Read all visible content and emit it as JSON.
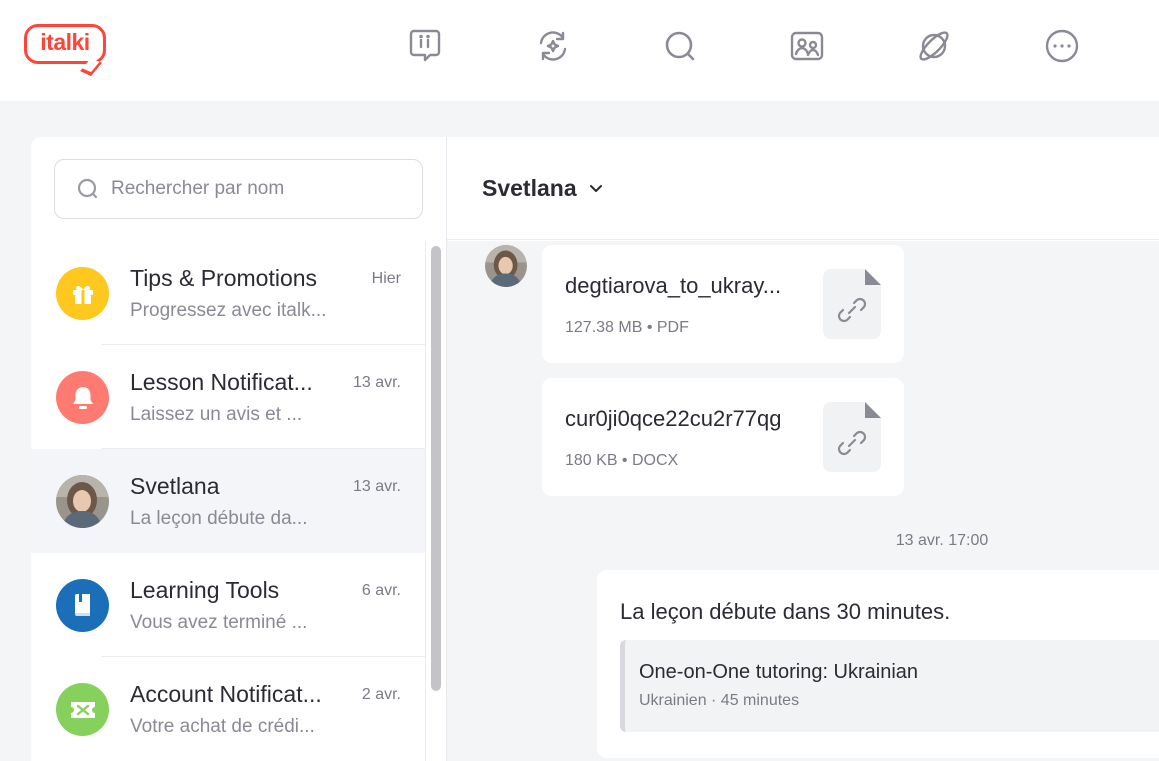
{
  "brand": {
    "logo_text": "italki",
    "color": "#ff4438"
  },
  "nav": [
    {
      "name": "italki-ii-icon"
    },
    {
      "name": "exchange-icon"
    },
    {
      "name": "search-icon"
    },
    {
      "name": "teachers-icon"
    },
    {
      "name": "planet-icon"
    },
    {
      "name": "more-icon"
    }
  ],
  "search": {
    "placeholder": "Rechercher par nom"
  },
  "conversations": [
    {
      "name": "Tips & Promotions",
      "date": "Hier",
      "preview": "Progressez avec italk...",
      "icon": "gift-icon",
      "color": "#ffc81e"
    },
    {
      "name": "Lesson Notificat...",
      "date": "13 avr.",
      "preview": "Laissez un avis et ...",
      "icon": "bell-icon",
      "color": "#ff7b72"
    },
    {
      "name": "Svetlana",
      "date": "13 avr.",
      "preview": "La leçon débute da...",
      "icon": "avatar-photo",
      "color": "#8d8a86"
    },
    {
      "name": "Learning Tools",
      "date": "6 avr.",
      "preview": "Vous avez terminé ...",
      "icon": "book-icon",
      "color": "#1a6fb8"
    },
    {
      "name": "Account Notificat...",
      "date": "2 avr.",
      "preview": "Votre achat de crédi...",
      "icon": "ticket-icon",
      "color": "#86d05c"
    }
  ],
  "chat": {
    "title": "Svetlana",
    "files": [
      {
        "name": "degtiarova_to_ukray...",
        "meta": "127.38 MB • PDF"
      },
      {
        "name": "cur0ji0qce22cu2r77qg",
        "meta": "180 KB • DOCX"
      }
    ],
    "timestamp": "13 avr. 17:00",
    "message": "La leçon débute dans 30 minutes.",
    "lesson": {
      "title": "One-on-One tutoring: Ukrainian",
      "subtitle": "Ukrainien · 45 minutes"
    }
  }
}
